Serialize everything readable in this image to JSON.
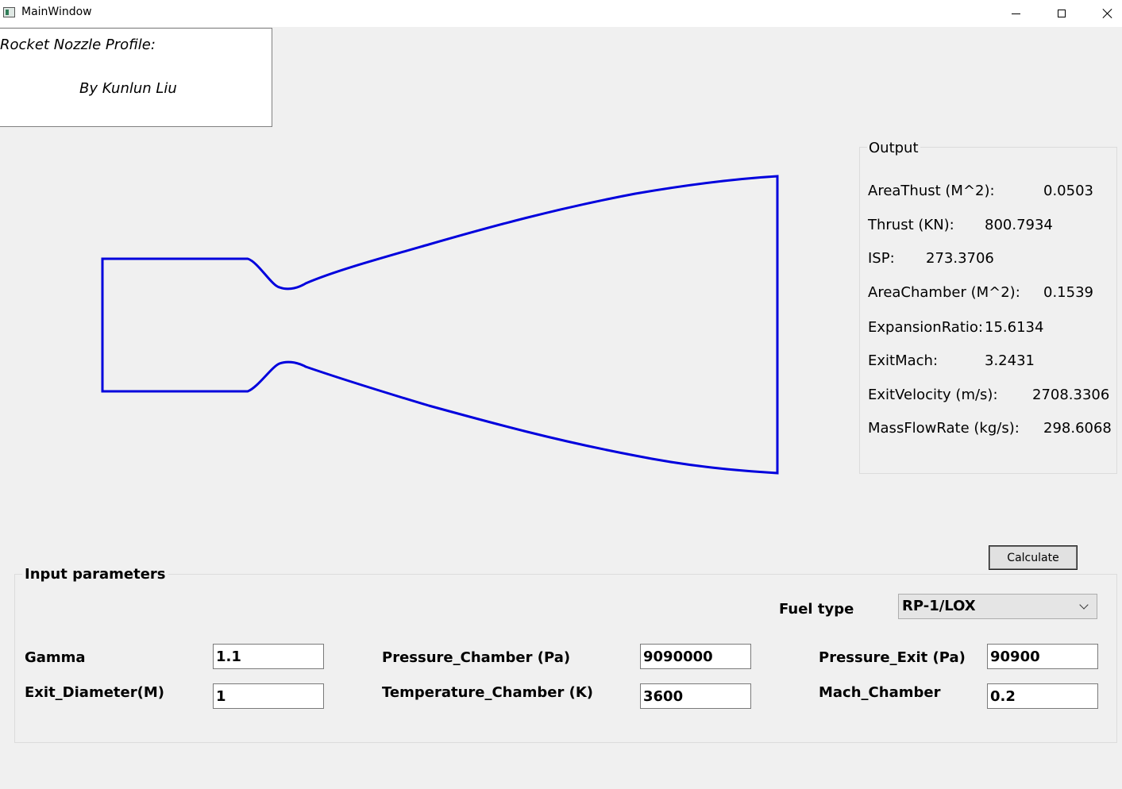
{
  "window": {
    "title": "MainWindow"
  },
  "header": {
    "line1": "Rocket Nozzle Profile:",
    "line2": "By Kunlun Liu"
  },
  "nozzle": {
    "stroke_color": "#0000dd"
  },
  "output": {
    "title": "Output",
    "rows": [
      {
        "label": "AreaThust (M^2):",
        "value": "0.0503"
      },
      {
        "label": "Thrust (KN):",
        "value": "800.7934"
      },
      {
        "label": "ISP:",
        "value": "273.3706"
      },
      {
        "label": "AreaChamber (M^2):",
        "value": "0.1539"
      },
      {
        "label": "ExpansionRatio:",
        "value": "15.6134"
      },
      {
        "label": "ExitMach:",
        "value": "3.2431"
      },
      {
        "label": "ExitVelocity (m/s):",
        "value": "2708.3306"
      },
      {
        "label": "MassFlowRate (kg/s):",
        "value": "298.6068"
      }
    ]
  },
  "calculate_label": "Calculate",
  "inputs": {
    "title": "Input parameters",
    "fuel_type": {
      "label": "Fuel type",
      "selected": "RP-1/LOX"
    },
    "gamma": {
      "label": "Gamma",
      "value": "1.1"
    },
    "exit_diameter": {
      "label": "Exit_Diameter(M)",
      "value": "1"
    },
    "pressure_chamber": {
      "label": "Pressure_Chamber (Pa)",
      "value": "9090000"
    },
    "temperature_chamber": {
      "label": "Temperature_Chamber (K)",
      "value": "3600"
    },
    "pressure_exit": {
      "label": "Pressure_Exit (Pa)",
      "value": "90900"
    },
    "mach_chamber": {
      "label": "Mach_Chamber",
      "value": "0.2"
    }
  }
}
